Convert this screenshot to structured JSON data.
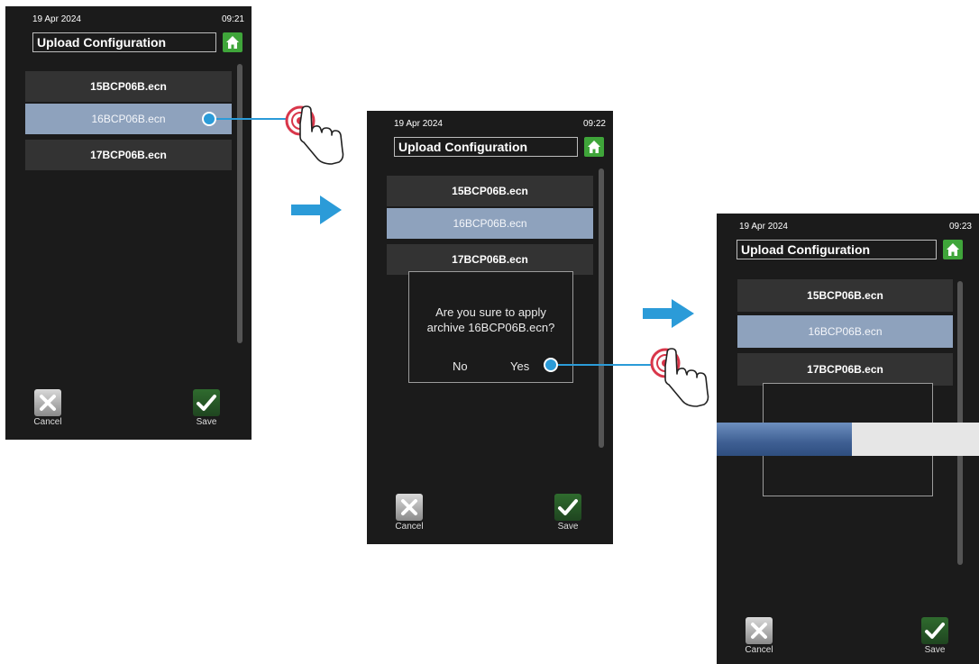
{
  "screens": [
    {
      "date": "19 Apr 2024",
      "time": "09:21",
      "title": "Upload Configuration",
      "files": [
        "15BCP06B.ecn",
        "16BCP06B.ecn",
        "17BCP06B.ecn"
      ],
      "selected_index": 1,
      "cancel_label": "Cancel",
      "save_label": "Save"
    },
    {
      "date": "19 Apr 2024",
      "time": "09:22",
      "title": "Upload Configuration",
      "files": [
        "15BCP06B.ecn",
        "16BCP06B.ecn",
        "17BCP06B.ecn"
      ],
      "selected_index": 1,
      "dialog": {
        "line1": "Are you sure to apply",
        "line2": "archive 16BCP06B.ecn?",
        "no_label": "No",
        "yes_label": "Yes"
      },
      "cancel_label": "Cancel",
      "save_label": "Save"
    },
    {
      "date": "19 Apr 2024",
      "time": "09:23",
      "title": "Upload Configuration",
      "files": [
        "15BCP06B.ecn",
        "16BCP06B.ecn",
        "17BCP06B.ecn"
      ],
      "selected_index": 1,
      "progress_fraction": 0.515,
      "cancel_label": "Cancel",
      "save_label": "Save"
    }
  ],
  "colors": {
    "screen_bg": "#1b1b1b",
    "item_bg": "#333333",
    "item_selected_bg": "#8ea2bd",
    "home_green": "#3fa53a",
    "annotation_blue": "#2b9bd8",
    "touch_red": "#d9364a"
  },
  "icons": {
    "home": "home-icon",
    "cancel": "x-icon",
    "save": "checkmark-icon",
    "tap": "tap-hand-icon",
    "next": "arrow-right-icon"
  }
}
